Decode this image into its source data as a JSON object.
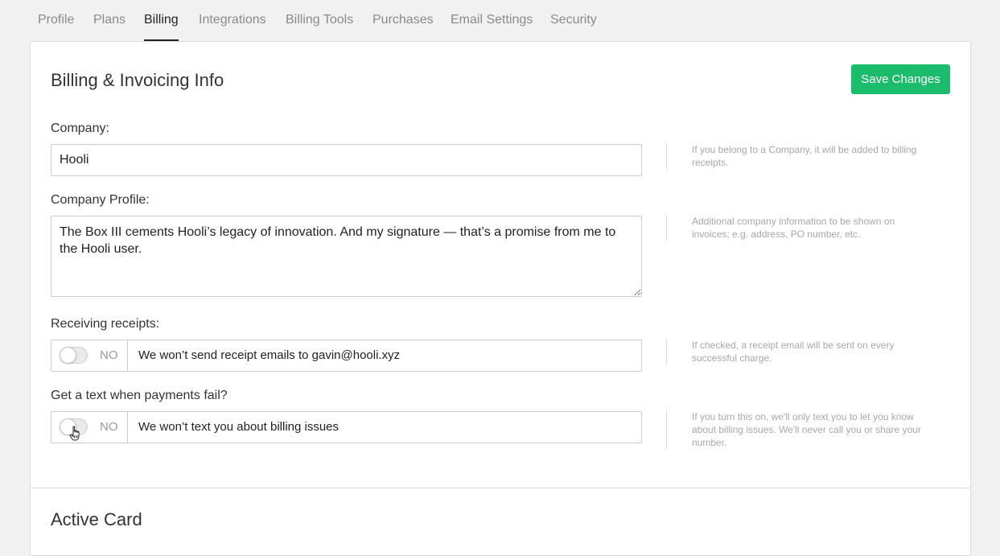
{
  "tabs": [
    {
      "label": "Profile",
      "active": false
    },
    {
      "label": "Plans",
      "active": false
    },
    {
      "label": "Billing",
      "active": true
    },
    {
      "label": "Integrations",
      "active": false
    },
    {
      "label": "Billing Tools",
      "active": false
    },
    {
      "label": "Purchases",
      "active": false
    },
    {
      "label": "Email Settings",
      "active": false
    },
    {
      "label": "Security",
      "active": false
    }
  ],
  "billing": {
    "title": "Billing & Invoicing Info",
    "save_label": "Save Changes",
    "company": {
      "label": "Company:",
      "value": "Hooli",
      "help": "If you belong to a Company, it will be added to billing receipts."
    },
    "company_profile": {
      "label": "Company Profile:",
      "value": "The Box III cements Hooli’s legacy of innovation. And my signature — that’s a promise from me to the Hooli user.",
      "help": "Additional company information to be shown on invoices; e.g. address, PO number, etc."
    },
    "receipts": {
      "label": "Receiving receipts:",
      "state": "NO",
      "checked": false,
      "description": "We won’t send receipt emails to gavin@hooli.xyz",
      "help": "If checked, a receipt email will be sent on every successful charge."
    },
    "text_alerts": {
      "label": "Get a text when payments fail?",
      "state": "NO",
      "checked": false,
      "description": "We won’t text you about billing issues",
      "help": "If you turn this on, we'll only text you to let you know about billing issues. We'll never call you or share your number."
    }
  },
  "active_card": {
    "title": "Active Card"
  },
  "colors": {
    "accent": "#1bbd6c",
    "background": "#f0f1f0",
    "panel": "#ffffff",
    "muted_text": "#a6a8a6"
  }
}
